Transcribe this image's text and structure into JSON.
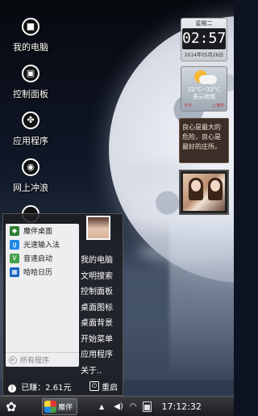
{
  "desktop": {
    "icons": [
      {
        "label": "我的电脑",
        "icon": "computer-icon",
        "glyph": "■"
      },
      {
        "label": "控制面板",
        "icon": "control-panel-icon",
        "glyph": "▣"
      },
      {
        "label": "应用程序",
        "icon": "apps-icon",
        "glyph": "✤"
      },
      {
        "label": "网上冲浪",
        "icon": "globe-icon",
        "glyph": "◉"
      },
      {
        "label": "",
        "icon": "chat-icon",
        "glyph": "…"
      }
    ]
  },
  "widgets": {
    "clock": {
      "weekday": "星期二",
      "time": "02:57",
      "date": "2014年05月26日"
    },
    "weather": {
      "temp": "22°C~32°C",
      "desc": "多云转晴",
      "foot_left": "今日",
      "foot_right": "上海市"
    },
    "quote": {
      "lines": [
        "良心是最大的",
        "危险，良心是",
        "最好的庄所。"
      ]
    }
  },
  "start_menu": {
    "apps": [
      {
        "label": "魔伴桌面",
        "icon": "mobanzhuomian-icon",
        "color": "#2e7d32",
        "glyph": "◆"
      },
      {
        "label": "光速输入法",
        "icon": "input-method-icon",
        "color": "#1e88e5",
        "glyph": "g"
      },
      {
        "label": "音速启动",
        "icon": "launcher-icon",
        "color": "#43a047",
        "glyph": "V"
      },
      {
        "label": "哈哈日历",
        "icon": "calendar-icon",
        "color": "#1565c0",
        "glyph": "▦"
      }
    ],
    "all_programs": "所有程序",
    "links": [
      "我的电脑",
      "文明搜索",
      "控制面板",
      "桌面图标",
      "桌面背景",
      "开始菜单",
      "应用程序",
      "关于.."
    ],
    "balance": "已赚：2.61元",
    "restart": "重启"
  },
  "taskbar": {
    "start_glyph": "✿",
    "app_label": "魔伴",
    "tray_arrow": "▲",
    "volume_glyph": "◀)",
    "wifi_glyph": "◠",
    "time": "17:12:32"
  }
}
